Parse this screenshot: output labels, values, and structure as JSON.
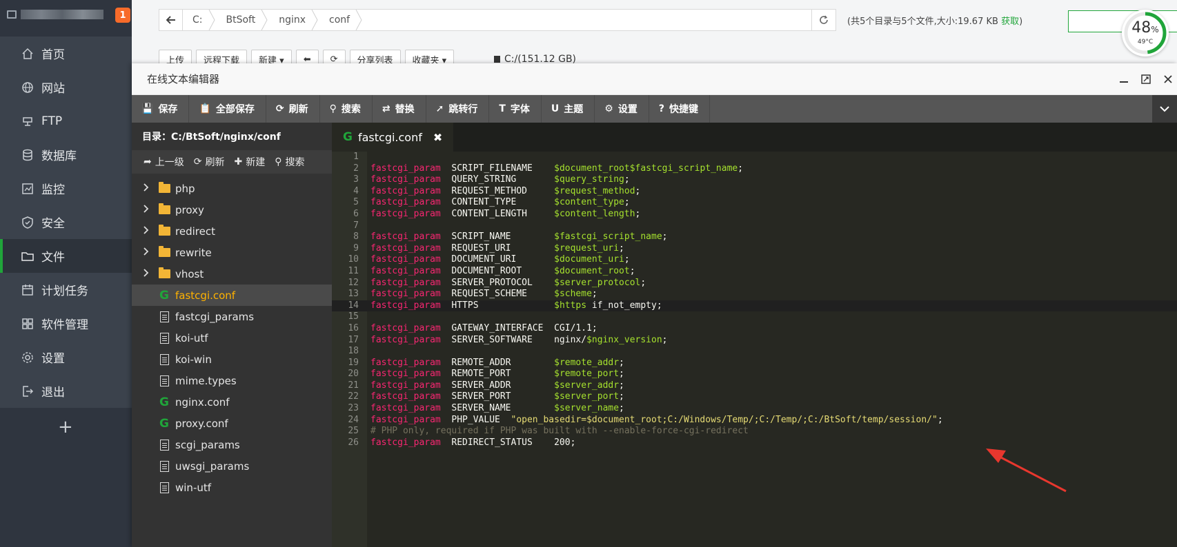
{
  "sidebar": {
    "badge": "1",
    "items": [
      {
        "label": "首页",
        "icon": "home-icon"
      },
      {
        "label": "网站",
        "icon": "globe-icon"
      },
      {
        "label": "FTP",
        "icon": "ftp-icon"
      },
      {
        "label": "数据库",
        "icon": "database-icon"
      },
      {
        "label": "监控",
        "icon": "monitor-icon"
      },
      {
        "label": "安全",
        "icon": "shield-icon"
      },
      {
        "label": "文件",
        "icon": "folder-icon"
      },
      {
        "label": "计划任务",
        "icon": "calendar-icon"
      },
      {
        "label": "软件管理",
        "icon": "apps-icon"
      },
      {
        "label": "设置",
        "icon": "gear-icon"
      },
      {
        "label": "退出",
        "icon": "logout-icon"
      }
    ],
    "active_index": 6,
    "add_label": "+"
  },
  "file_manager": {
    "breadcrumbs": [
      "C:",
      "BtSoft",
      "nginx",
      "conf"
    ],
    "dir_info": "(共5个目录与5个文件,大小:19.67 KB",
    "dir_info_link": "获取",
    "dir_info_end": ")",
    "gauge": {
      "percent": "48",
      "unit": "%",
      "temp": "49°C",
      "value": 0.48
    },
    "toolbar": [
      "上传",
      "远程下载",
      "新建 ▾",
      "⬅",
      "⟳",
      "分享列表",
      "收藏夹 ▾"
    ],
    "disk": "C:/(151.12 GB)"
  },
  "editor": {
    "title": "在线文本编辑器",
    "toolbar": [
      {
        "label": "保存",
        "icon": "save-icon",
        "glyph": "💾"
      },
      {
        "label": "全部保存",
        "icon": "save-all-icon",
        "glyph": "📋"
      },
      {
        "label": "刷新",
        "icon": "refresh-icon",
        "glyph": "⟳"
      },
      {
        "label": "搜索",
        "icon": "search-icon",
        "glyph": "⚲"
      },
      {
        "label": "替换",
        "icon": "replace-icon",
        "glyph": "⇄"
      },
      {
        "label": "跳转行",
        "icon": "goto-line-icon",
        "glyph": "➚"
      },
      {
        "label": "字体",
        "icon": "font-icon",
        "glyph": "T"
      },
      {
        "label": "主题",
        "icon": "magnet-icon",
        "glyph": "U"
      },
      {
        "label": "设置",
        "icon": "gear-icon",
        "glyph": "⚙"
      },
      {
        "label": "快捷键",
        "icon": "help-icon",
        "glyph": "?"
      }
    ],
    "tree": {
      "path": "目录：C:/BtSoft/nginx/conf",
      "actions": [
        {
          "label": "上一级",
          "icon": "up-level-icon",
          "glyph": "➦"
        },
        {
          "label": "刷新",
          "icon": "refresh-icon",
          "glyph": "⟳"
        },
        {
          "label": "新建",
          "icon": "plus-icon",
          "glyph": "✚"
        },
        {
          "label": "搜索",
          "icon": "search-icon",
          "glyph": "⚲"
        }
      ],
      "items": [
        {
          "name": "php",
          "type": "folder"
        },
        {
          "name": "proxy",
          "type": "folder"
        },
        {
          "name": "redirect",
          "type": "folder"
        },
        {
          "name": "rewrite",
          "type": "folder"
        },
        {
          "name": "vhost",
          "type": "folder"
        },
        {
          "name": "fastcgi.conf",
          "type": "conf",
          "active": true
        },
        {
          "name": "fastcgi_params",
          "type": "file"
        },
        {
          "name": "koi-utf",
          "type": "file"
        },
        {
          "name": "koi-win",
          "type": "file"
        },
        {
          "name": "mime.types",
          "type": "file"
        },
        {
          "name": "nginx.conf",
          "type": "conf"
        },
        {
          "name": "proxy.conf",
          "type": "conf"
        },
        {
          "name": "scgi_params",
          "type": "file"
        },
        {
          "name": "uwsgi_params",
          "type": "file"
        },
        {
          "name": "win-utf",
          "type": "file"
        }
      ]
    },
    "tab": {
      "label": "fastcgi.conf",
      "close": "✖"
    },
    "highlighted_line": 14,
    "code": [
      [],
      [
        [
          "kw",
          "fastcgi_param"
        ],
        [
          "t",
          "  SCRIPT_FILENAME    "
        ],
        [
          "var",
          "$document_root$fastcgi_script_name"
        ],
        [
          "t",
          ";"
        ]
      ],
      [
        [
          "kw",
          "fastcgi_param"
        ],
        [
          "t",
          "  QUERY_STRING       "
        ],
        [
          "var",
          "$query_string"
        ],
        [
          "t",
          ";"
        ]
      ],
      [
        [
          "kw",
          "fastcgi_param"
        ],
        [
          "t",
          "  REQUEST_METHOD     "
        ],
        [
          "var",
          "$request_method"
        ],
        [
          "t",
          ";"
        ]
      ],
      [
        [
          "kw",
          "fastcgi_param"
        ],
        [
          "t",
          "  CONTENT_TYPE       "
        ],
        [
          "var",
          "$content_type"
        ],
        [
          "t",
          ";"
        ]
      ],
      [
        [
          "kw",
          "fastcgi_param"
        ],
        [
          "t",
          "  CONTENT_LENGTH     "
        ],
        [
          "var",
          "$content_length"
        ],
        [
          "t",
          ";"
        ]
      ],
      [],
      [
        [
          "kw",
          "fastcgi_param"
        ],
        [
          "t",
          "  SCRIPT_NAME        "
        ],
        [
          "var",
          "$fastcgi_script_name"
        ],
        [
          "t",
          ";"
        ]
      ],
      [
        [
          "kw",
          "fastcgi_param"
        ],
        [
          "t",
          "  REQUEST_URI        "
        ],
        [
          "var",
          "$request_uri"
        ],
        [
          "t",
          ";"
        ]
      ],
      [
        [
          "kw",
          "fastcgi_param"
        ],
        [
          "t",
          "  DOCUMENT_URI       "
        ],
        [
          "var",
          "$document_uri"
        ],
        [
          "t",
          ";"
        ]
      ],
      [
        [
          "kw",
          "fastcgi_param"
        ],
        [
          "t",
          "  DOCUMENT_ROOT      "
        ],
        [
          "var",
          "$document_root"
        ],
        [
          "t",
          ";"
        ]
      ],
      [
        [
          "kw",
          "fastcgi_param"
        ],
        [
          "t",
          "  SERVER_PROTOCOL    "
        ],
        [
          "var",
          "$server_protocol"
        ],
        [
          "t",
          ";"
        ]
      ],
      [
        [
          "kw",
          "fastcgi_param"
        ],
        [
          "t",
          "  REQUEST_SCHEME     "
        ],
        [
          "var",
          "$scheme"
        ],
        [
          "t",
          ";"
        ]
      ],
      [
        [
          "kw",
          "fastcgi_param"
        ],
        [
          "t",
          "  HTTPS              "
        ],
        [
          "var",
          "$https"
        ],
        [
          "t",
          " if_not_empty;"
        ]
      ],
      [],
      [
        [
          "kw",
          "fastcgi_param"
        ],
        [
          "t",
          "  GATEWAY_INTERFACE  CGI/1.1;"
        ]
      ],
      [
        [
          "kw",
          "fastcgi_param"
        ],
        [
          "t",
          "  SERVER_SOFTWARE    nginx/"
        ],
        [
          "var",
          "$nginx_version"
        ],
        [
          "t",
          ";"
        ]
      ],
      [],
      [
        [
          "kw",
          "fastcgi_param"
        ],
        [
          "t",
          "  REMOTE_ADDR        "
        ],
        [
          "var",
          "$remote_addr"
        ],
        [
          "t",
          ";"
        ]
      ],
      [
        [
          "kw",
          "fastcgi_param"
        ],
        [
          "t",
          "  REMOTE_PORT        "
        ],
        [
          "var",
          "$remote_port"
        ],
        [
          "t",
          ";"
        ]
      ],
      [
        [
          "kw",
          "fastcgi_param"
        ],
        [
          "t",
          "  SERVER_ADDR        "
        ],
        [
          "var",
          "$server_addr"
        ],
        [
          "t",
          ";"
        ]
      ],
      [
        [
          "kw",
          "fastcgi_param"
        ],
        [
          "t",
          "  SERVER_PORT        "
        ],
        [
          "var",
          "$server_port"
        ],
        [
          "t",
          ";"
        ]
      ],
      [
        [
          "kw",
          "fastcgi_param"
        ],
        [
          "t",
          "  SERVER_NAME        "
        ],
        [
          "var",
          "$server_name"
        ],
        [
          "t",
          ";"
        ]
      ],
      [
        [
          "kw",
          "fastcgi_param"
        ],
        [
          "t",
          "  PHP_VALUE  "
        ],
        [
          "str",
          "\"open_basedir=$document_root;C:/Windows/Temp/;C:/Temp/;C:/BtSoft/temp/session/\""
        ],
        [
          "t",
          ";"
        ]
      ],
      [
        [
          "cmt",
          "# PHP only, required if PHP was built with --enable-force-cgi-redirect"
        ]
      ],
      [
        [
          "kw",
          "fastcgi_param"
        ],
        [
          "t",
          "  REDIRECT_STATUS    200;"
        ]
      ]
    ]
  },
  "colors": {
    "accent": "#20a53a",
    "annotation_arrow": "#e8372e"
  }
}
